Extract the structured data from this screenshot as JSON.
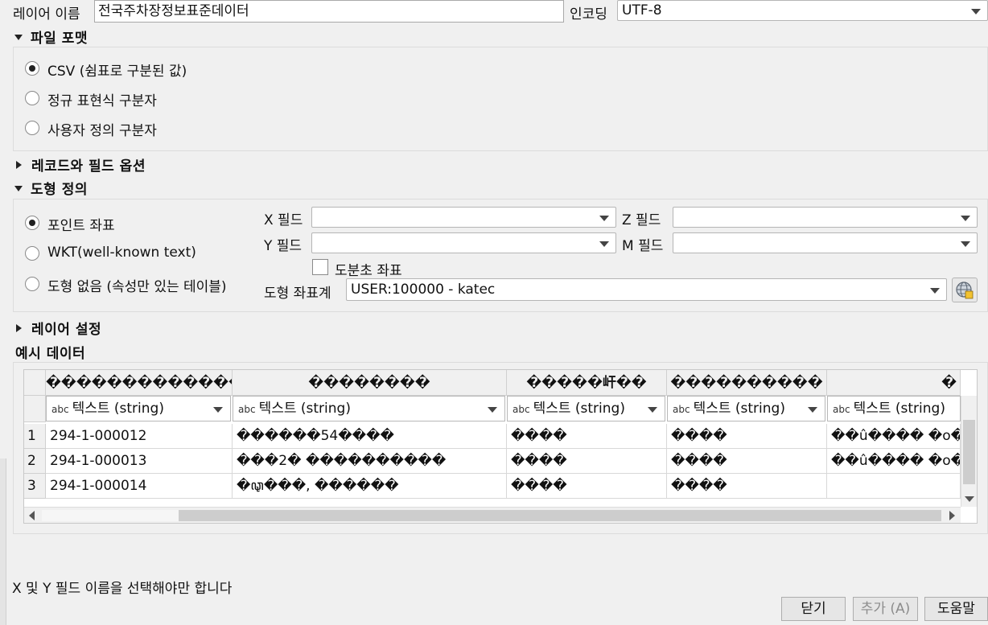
{
  "top": {
    "layer_name_label": "레이어 이름",
    "layer_name_value": "전국주차장정보표준데이터",
    "encoding_label": "인코딩",
    "encoding_value": "UTF-8"
  },
  "file_format": {
    "title": "파일 포맷",
    "options": [
      "CSV (쉼표로 구분된 값)",
      "정규 표현식 구분자",
      "사용자 정의 구분자"
    ],
    "selected": 0
  },
  "records_fields": {
    "title": "레코드와 필드 옵션"
  },
  "geometry": {
    "title": "도형 정의",
    "options": [
      "포인트 좌표",
      "WKT(well-known text)",
      "도형 없음 (속성만 있는 테이블)"
    ],
    "selected": 0,
    "x_label": "X 필드",
    "y_label": "Y 필드",
    "z_label": "Z 필드",
    "m_label": "M 필드",
    "x_value": "",
    "y_value": "",
    "z_value": "",
    "m_value": "",
    "dms_label": "도분초 좌표",
    "crs_label": "도형 좌표계",
    "crs_value": "USER:100000 - katec"
  },
  "layer_settings": {
    "title": "레이어 설정"
  },
  "sample": {
    "title": "예시 데이터",
    "headers": [
      "�������������8",
      "��������",
      "�����屽��",
      "����������",
      "�"
    ],
    "type_label": "텍스트 (string)",
    "type_prefix": "abc",
    "rows": [
      {
        "num": "1",
        "cells": [
          "294-1-000012",
          "������54����",
          "����",
          "����",
          "��û���� �o�"
        ]
      },
      {
        "num": "2",
        "cells": [
          "294-1-000013",
          "���2� ����������",
          "����",
          "����",
          "��û���� �o�"
        ]
      },
      {
        "num": "3",
        "cells": [
          "294-1-000014",
          "�ꦡ���, ������",
          "����",
          "����",
          ""
        ]
      }
    ]
  },
  "status_message": "X 및 Y 필드 이름을 선택해야만 합니다",
  "buttons": {
    "close": "닫기",
    "add": "추가 (A)",
    "help": "도움말"
  },
  "icons": {
    "expanded": "triangle-down-icon",
    "collapsed": "triangle-right-icon",
    "crs": "globe-crs-icon"
  }
}
